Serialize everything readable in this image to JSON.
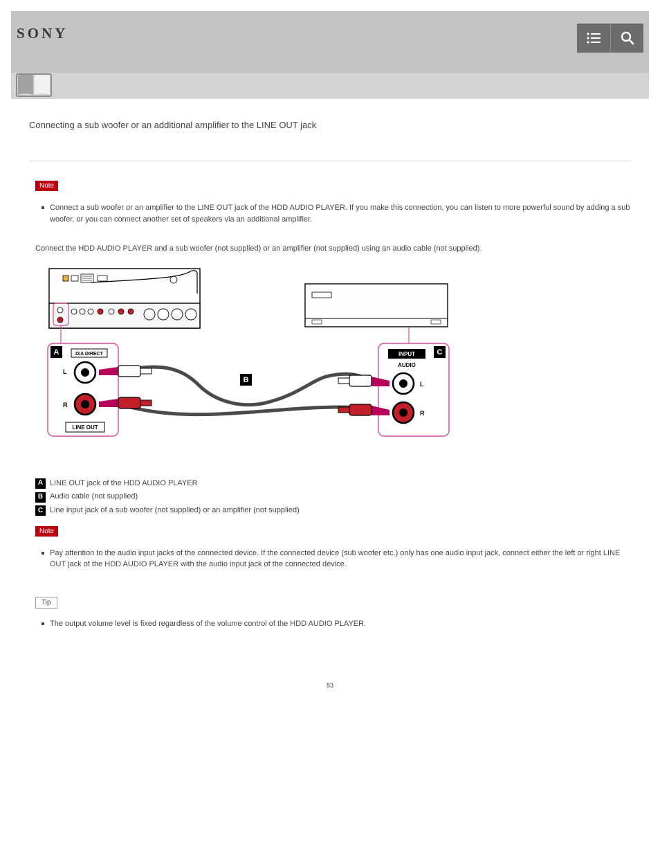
{
  "brand": "SONY",
  "header": {
    "menu_icon": "menu-icon",
    "search_icon": "search-icon",
    "book_icon": "help-guide-book-icon"
  },
  "title": "Connecting a sub woofer or an additional amplifier to the LINE OUT jack",
  "note1_label": "Note",
  "note1_text": "Connect a sub woofer or an amplifier to the LINE OUT jack of the HDD AUDIO PLAYER. If you make this connection, you can listen to more powerful sound by adding a sub woofer, or you can connect another set of speakers via an additional amplifier.",
  "intro": "Connect the HDD AUDIO PLAYER and a sub woofer (not supplied) or an amplifier (not supplied) using an audio cable (not supplied).",
  "diagram": {
    "left_device": "HDD AUDIO PLAYER rear panel",
    "right_device": "External amplifier / sub woofer",
    "panel_A_title": "D/A DIRECT",
    "panel_A_sub": "LINE OUT",
    "panel_C_title": "INPUT",
    "panel_C_sub": "AUDIO",
    "cable_B": "Audio cable",
    "L": "L",
    "R": "R"
  },
  "legend": {
    "A": "LINE OUT jack of the HDD AUDIO PLAYER",
    "B": "Audio cable (not supplied)",
    "C": "Line input jack of a sub woofer (not supplied) or an amplifier (not supplied)"
  },
  "note2_label": "Note",
  "note2_text": "Pay attention to the audio input jacks of the connected device. If the connected device (sub woofer etc.) only has one audio input jack, connect either the left or right LINE OUT jack of the HDD AUDIO PLAYER with the audio input jack of the connected device.",
  "tip_label": "Tip",
  "tip_text": "The output volume level is fixed regardless of the volume control of the HDD AUDIO PLAYER.",
  "page_number": "83"
}
